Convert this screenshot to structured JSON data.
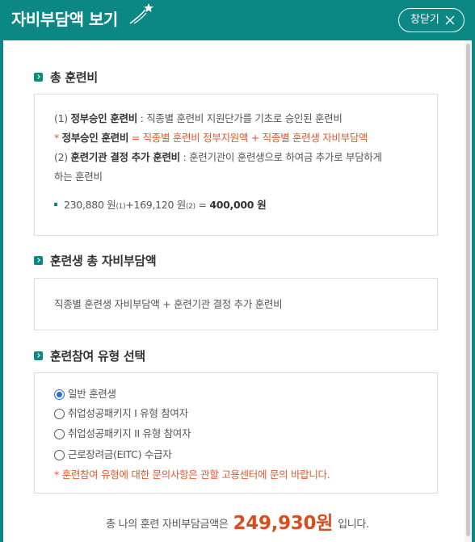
{
  "header": {
    "title": "자비부담액 보기",
    "close_label": "창닫기"
  },
  "sections": {
    "total_fee": {
      "title": "총 훈련비",
      "line1_prefix": "(1) ",
      "line1_bold": "정부승인 훈련비",
      "line1_rest": " : 직종별 훈련비 지원단가를 기초로 승인된 훈련비",
      "note_prefix": "* ",
      "note_bold": "정부승인 훈련비",
      "note_rest": " = 직종별 훈련비 정부지원액 + 직종별 훈련생 자비부담액",
      "line2_prefix": "(2) ",
      "line2_bold": "훈련기관 결정 추가 훈련비",
      "line2_rest": " : 훈련기관이 훈련생으로 하여금 추가로 부담하게",
      "line2_cont": "하는 훈련비",
      "calc_a": "230,880 원",
      "calc_a_sub": "(1)",
      "calc_plus": "+169,120 원",
      "calc_b_sub": "(2)",
      "calc_eq": " = ",
      "calc_total": "400,000 원"
    },
    "self_pay": {
      "title": "훈련생 총 자비부담액",
      "formula": "직종별 훈련생 자비부담액 + 훈련기관 결정 추가 훈련비"
    },
    "type_select": {
      "title": "훈련참여 유형 선택",
      "options": [
        {
          "label": "일반 훈련생",
          "checked": true
        },
        {
          "label": "취업성공패키지 I 유형 참여자",
          "checked": false
        },
        {
          "label": "취업성공패키지 II 유형 참여자",
          "checked": false
        },
        {
          "label": "근로장려금(EITC) 수급자",
          "checked": false
        }
      ],
      "note": "* 훈련참여 유형에 대한 문의사항은 관할 고용센터에 문의 바랍니다."
    }
  },
  "total": {
    "prefix": "총 나의 훈련 자비부담금액은",
    "amount": "249,930원",
    "suffix": "입니다."
  },
  "colors": {
    "brand": "#0b8784",
    "accent": "#d64f20",
    "radio_selected": "#2a6fd6"
  }
}
